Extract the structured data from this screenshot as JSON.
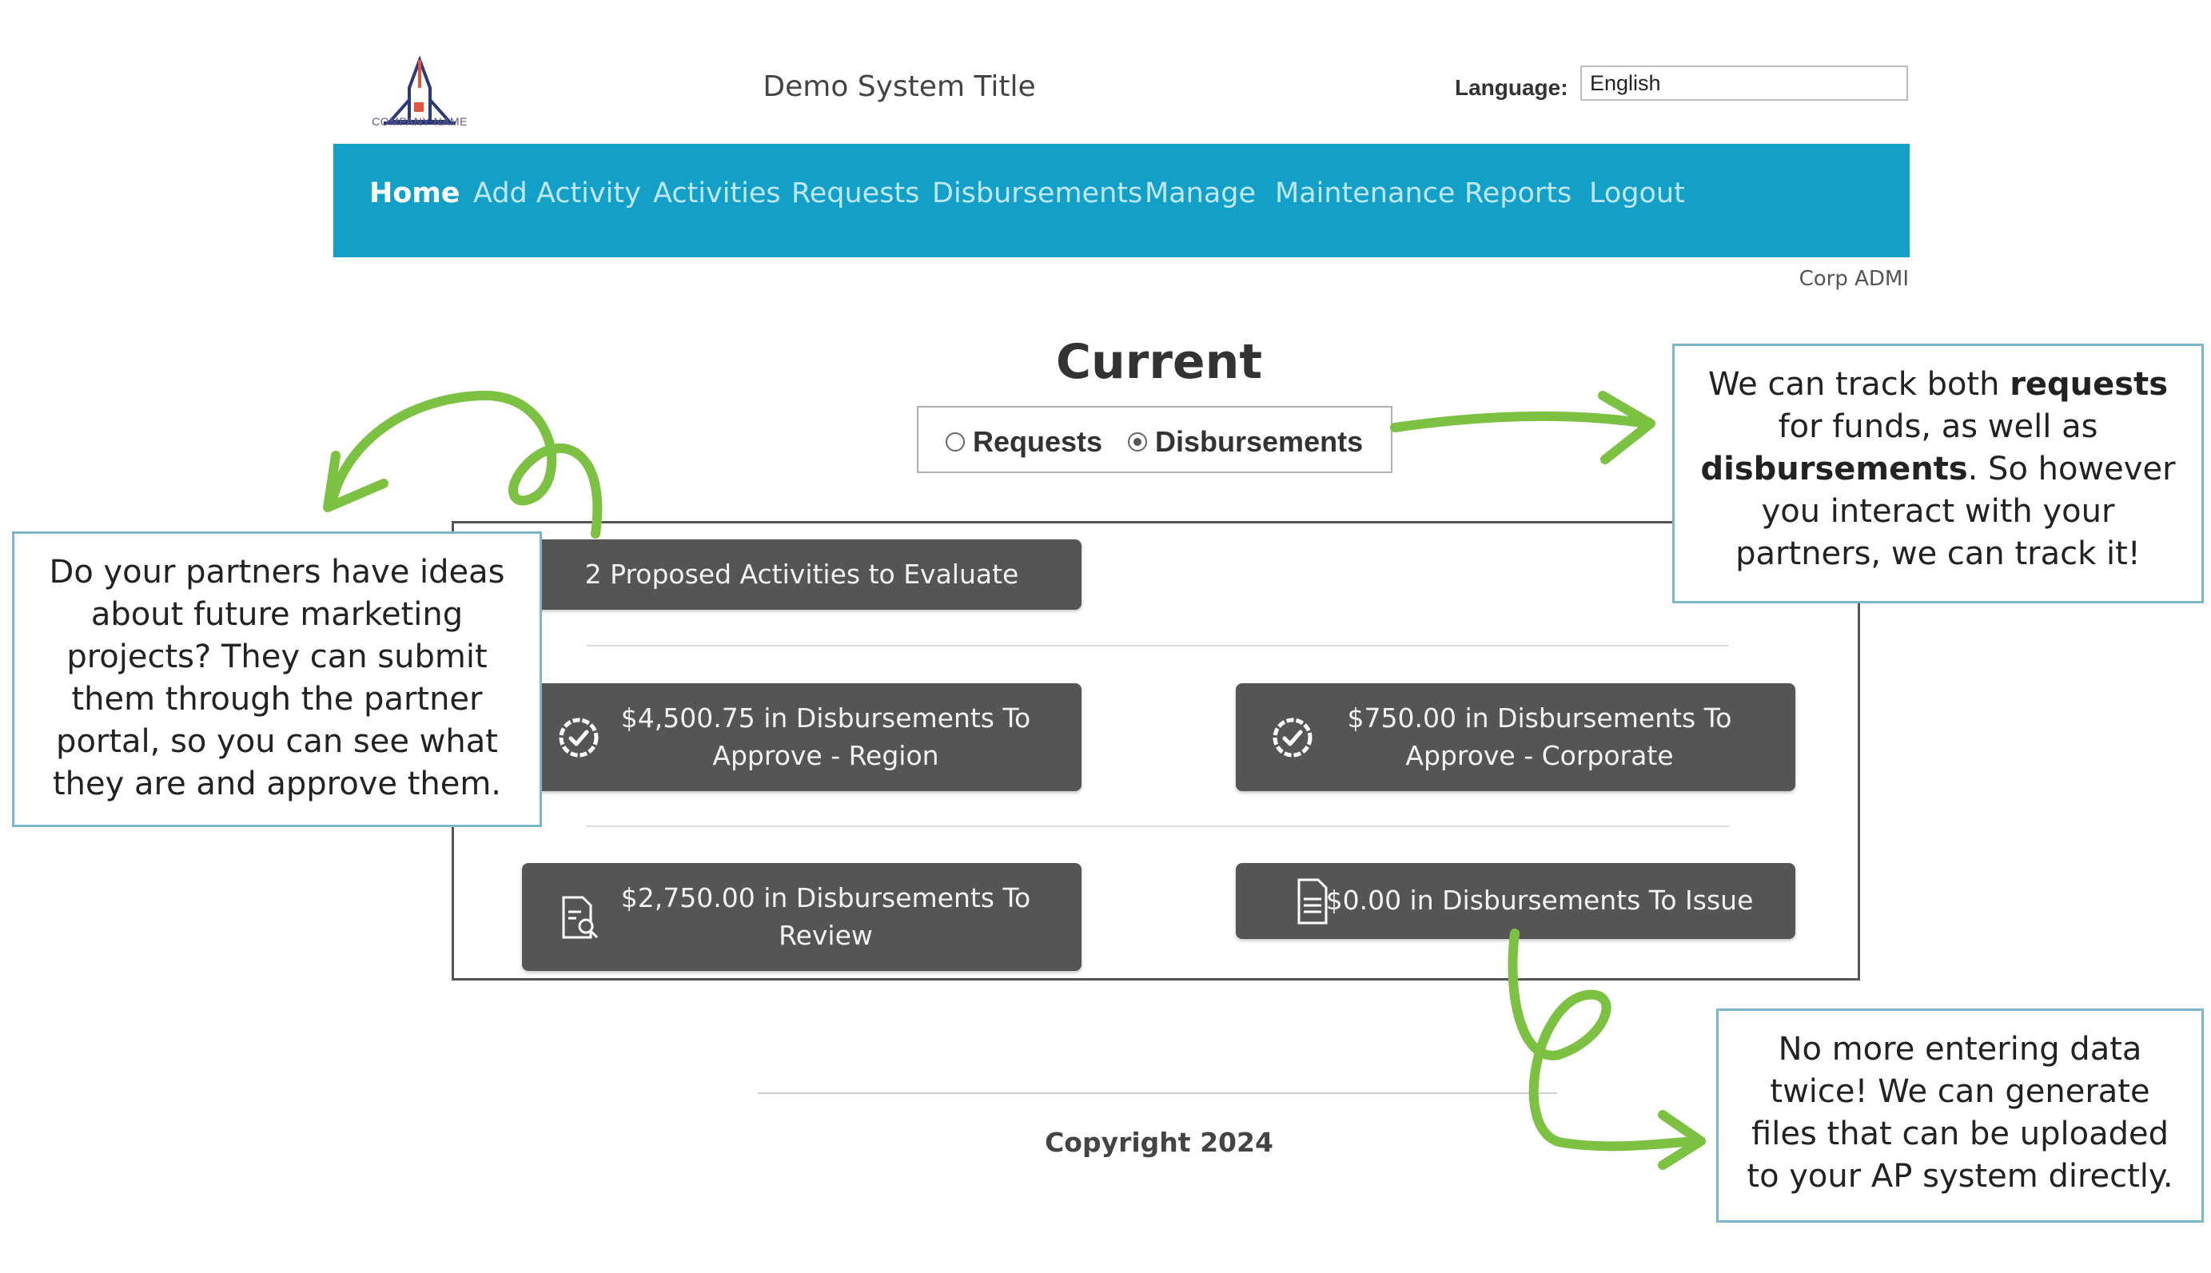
{
  "header": {
    "logo_caption": "COMPANY NAME",
    "system_title": "Demo System Title",
    "language_label": "Language:",
    "language_value": "English"
  },
  "nav": {
    "items": [
      {
        "label": "Home",
        "active": true
      },
      {
        "label": "Add Activity"
      },
      {
        "label": "Activities"
      },
      {
        "label": "Requests"
      },
      {
        "label": "Disbursements"
      },
      {
        "label": "Manage"
      },
      {
        "label": "Maintenance"
      },
      {
        "label": "Reports"
      },
      {
        "label": "Logout"
      }
    ],
    "bar_color": "#12a0c8"
  },
  "user": {
    "label": "Corp ADMI"
  },
  "current": {
    "title": "Current",
    "radio_requests": "Requests",
    "radio_disbursements": "Disbursements",
    "selected": "Disbursements"
  },
  "tiles": {
    "proposed": "2 Proposed Activities to Evaluate",
    "approve_region_line1": "$4,500.75 in Disbursements To",
    "approve_region_line2": "Approve - Region",
    "approve_corporate_line1": "$750.00 in Disbursements To",
    "approve_corporate_line2": "Approve - Corporate",
    "review_line1": "$2,750.00 in Disbursements To",
    "review_line2": "Review",
    "issue": "$0.00 in Disbursements To Issue",
    "icons": [
      "check-badge-icon",
      "check-badge-icon",
      "document-search-icon",
      "document-icon"
    ]
  },
  "footer": {
    "copyright": "Copyright 2024"
  },
  "callouts": {
    "left_lines": [
      "Do your partners have ideas",
      "about future marketing",
      "projects? They can submit",
      "them through the partner",
      "portal, so you can see what",
      "they are and approve them."
    ],
    "right_top": {
      "line1_pre": "We can track both ",
      "line1_bold": "requests",
      "line2": "for funds, as well as",
      "line3_bold": "disbursements",
      "line3_post": ". So however",
      "line4": "you interact with your",
      "line5": "partners, we can track it!"
    },
    "right_bottom_lines": [
      "No more entering data",
      "twice! We can generate",
      "files that can be uploaded",
      "to your AP system directly."
    ],
    "arrow_color": "#7dc142",
    "border_color": "#7bb7cc"
  }
}
